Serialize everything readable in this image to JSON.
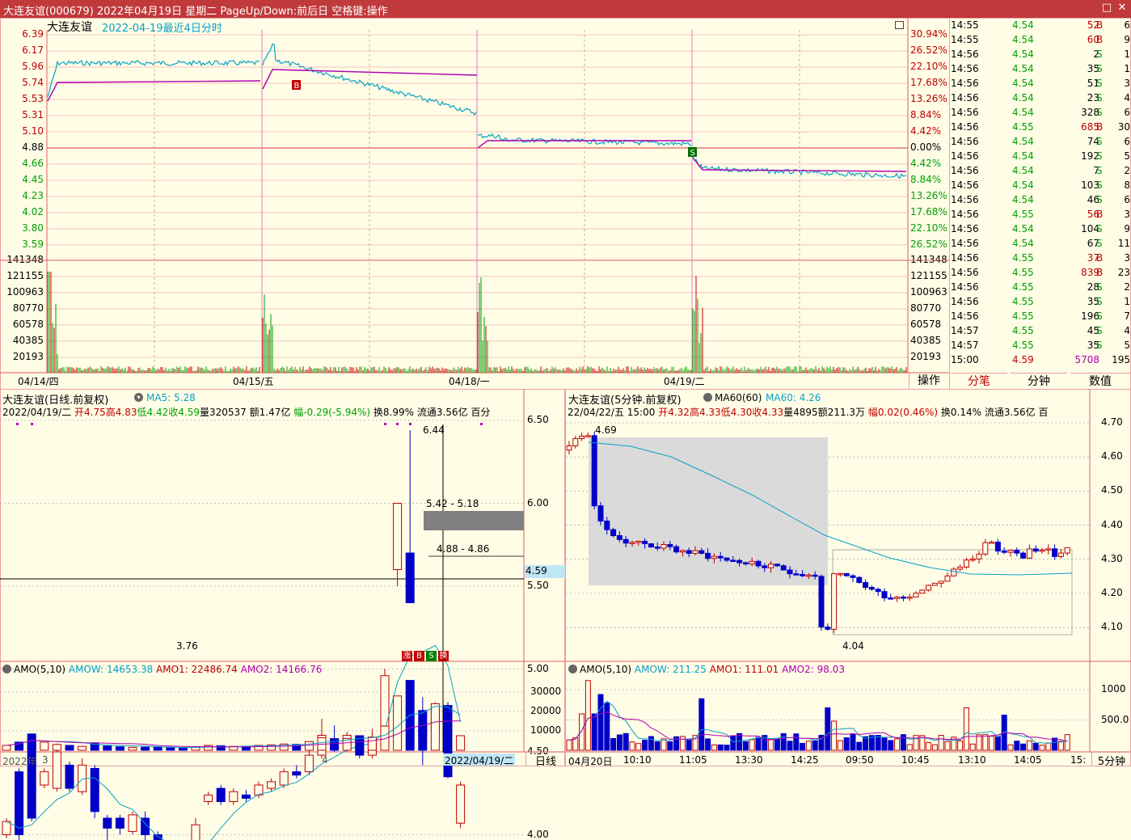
{
  "window": {
    "title": "大连友谊(000679) 2022年04月19日 星期二 PageUp/Down:前后日 空格键:操作",
    "btn_maximize": "□",
    "btn_close": "✕"
  },
  "intraday": {
    "stock_name": "大连友谊",
    "subtitle": "2022-04-19最近4日分时",
    "price_ticks": [
      "6.39",
      "6.17",
      "5.96",
      "5.74",
      "5.53",
      "5.31",
      "5.10",
      "4.88",
      "4.66",
      "4.45",
      "4.23",
      "4.02",
      "3.80",
      "3.59"
    ],
    "pct_ticks": [
      "30.94%",
      "26.52%",
      "22.10%",
      "17.68%",
      "13.26%",
      "8.84%",
      "4.42%",
      "0.00%",
      "4.42%",
      "8.84%",
      "13.26%",
      "17.68%",
      "22.10%",
      "26.52%"
    ],
    "vol_ticks": [
      "141348",
      "121155",
      "100963",
      "80770",
      "60578",
      "40385",
      "20193"
    ],
    "dates": [
      "04/14/四",
      "04/15/五",
      "04/18/一",
      "04/19/二"
    ],
    "marker_b": "B",
    "marker_s": "S",
    "ops_button": "操作"
  },
  "ticks": [
    {
      "time": "14:55",
      "price": "4.54",
      "vol": "52",
      "bs": "B",
      "n": "6"
    },
    {
      "time": "14:55",
      "price": "4.54",
      "vol": "60",
      "bs": "B",
      "n": "9"
    },
    {
      "time": "14:56",
      "price": "4.54",
      "vol": "2",
      "bs": "S",
      "n": "1"
    },
    {
      "time": "14:56",
      "price": "4.54",
      "vol": "35",
      "bs": "S",
      "n": "1"
    },
    {
      "time": "14:56",
      "price": "4.54",
      "vol": "51",
      "bs": "S",
      "n": "3"
    },
    {
      "time": "14:56",
      "price": "4.54",
      "vol": "23",
      "bs": "S",
      "n": "4"
    },
    {
      "time": "14:56",
      "price": "4.54",
      "vol": "328",
      "bs": "S",
      "n": "6"
    },
    {
      "time": "14:56",
      "price": "4.55",
      "vol": "685",
      "bs": "B",
      "n": "30"
    },
    {
      "time": "14:56",
      "price": "4.54",
      "vol": "74",
      "bs": "S",
      "n": "6"
    },
    {
      "time": "14:56",
      "price": "4.54",
      "vol": "192",
      "bs": "S",
      "n": "5"
    },
    {
      "time": "14:56",
      "price": "4.54",
      "vol": "7",
      "bs": "S",
      "n": "2"
    },
    {
      "time": "14:56",
      "price": "4.54",
      "vol": "103",
      "bs": "S",
      "n": "8"
    },
    {
      "time": "14:56",
      "price": "4.54",
      "vol": "46",
      "bs": "S",
      "n": "6"
    },
    {
      "time": "14:56",
      "price": "4.55",
      "vol": "56",
      "bs": "B",
      "n": "3"
    },
    {
      "time": "14:56",
      "price": "4.54",
      "vol": "104",
      "bs": "S",
      "n": "9"
    },
    {
      "time": "14:56",
      "price": "4.54",
      "vol": "67",
      "bs": "S",
      "n": "11"
    },
    {
      "time": "14:56",
      "price": "4.55",
      "vol": "37",
      "bs": "B",
      "n": "3"
    },
    {
      "time": "14:56",
      "price": "4.55",
      "vol": "839",
      "bs": "B",
      "n": "23"
    },
    {
      "time": "14:56",
      "price": "4.55",
      "vol": "28",
      "bs": "S",
      "n": "2"
    },
    {
      "time": "14:56",
      "price": "4.55",
      "vol": "35",
      "bs": "S",
      "n": "1"
    },
    {
      "time": "14:56",
      "price": "4.55",
      "vol": "196",
      "bs": "S",
      "n": "7"
    },
    {
      "time": "14:57",
      "price": "4.55",
      "vol": "45",
      "bs": "S",
      "n": "4"
    },
    {
      "time": "14:57",
      "price": "4.55",
      "vol": "35",
      "bs": "S",
      "n": "5"
    },
    {
      "time": "15:00",
      "price": "4.59",
      "vol": "5708",
      "bs": "",
      "n": "195"
    }
  ],
  "right_tabs": [
    "分笔",
    "分钟",
    "数值"
  ],
  "daily": {
    "title": "大连友谊(日线.前复权)",
    "ma_label": "MA5: 5.28",
    "info_date": "2022/04/19/二",
    "info_open": "开4.75",
    "info_high": "高4.83",
    "info_low": "低4.42",
    "info_close": "收4.59",
    "info_vol": "量320537",
    "info_amt": "额1.47亿",
    "info_chg": "幅-0.29(-5.94%)",
    "info_turn": "换8.99%",
    "info_float": "流通3.56亿",
    "info_more": "百分",
    "price_axis": [
      "6.50",
      "6.00",
      "5.50",
      "5.00",
      "4.50",
      "4.00"
    ],
    "current_price": "4.59",
    "label_high": "6.44",
    "label_low": "3.76",
    "band1": "5.42 - 5.18",
    "band2": "4.88 - 4.86",
    "markers": [
      "涨",
      "B",
      "S",
      "换"
    ],
    "amo_title": "AMO(5,10)",
    "amo_w": "AMOW: 14653.38",
    "amo_1": "AMO1: 22486.74",
    "amo_2": "AMO2: 14166.76",
    "amo_axis": [
      "30000",
      "20000",
      "10000"
    ],
    "x_labels": [
      "2022年",
      "3",
      "4"
    ],
    "cursor_date": "2022/04/19/二",
    "period_button": "日线"
  },
  "min5": {
    "title": "大连友谊(5分钟.前复权)",
    "ma_label": "MA60(60)",
    "ma_value": "MA60: 4.26",
    "info_date": "22/04/22/五",
    "info_time": "15:00",
    "info_open": "开4.32",
    "info_high": "高4.33",
    "info_low": "低4.30",
    "info_close": "收4.33",
    "info_vol": "量4895",
    "info_amt": "额211.3万",
    "info_chg": "幅0.02(0.46%)",
    "info_turn": "换0.14%",
    "info_float": "流通3.56亿",
    "info_more": "百",
    "price_axis": [
      "4.70",
      "4.60",
      "4.50",
      "4.40",
      "4.30",
      "4.20",
      "4.10"
    ],
    "label_high": "4.69",
    "label_low": "4.04",
    "amo_title": "AMO(5,10)",
    "amo_w": "AMOW: 211.25",
    "amo_1": "AMO1: 111.01",
    "amo_2": "AMO2: 98.03",
    "amo_axis": [
      "1000",
      "500.0"
    ],
    "x_labels": [
      "04月20日",
      "10:10",
      "11:05",
      "13:30",
      "14:25",
      "09:50",
      "10:45",
      "13:10",
      "14:05",
      "15:"
    ],
    "period_button": "5分钟"
  },
  "colors": {
    "titlebar": "#c0393b",
    "background": "#fffde6",
    "up": "#c00000",
    "down": "#0000c8",
    "price_line": "#0aa0c8",
    "avg_line": "#b000b0"
  }
}
